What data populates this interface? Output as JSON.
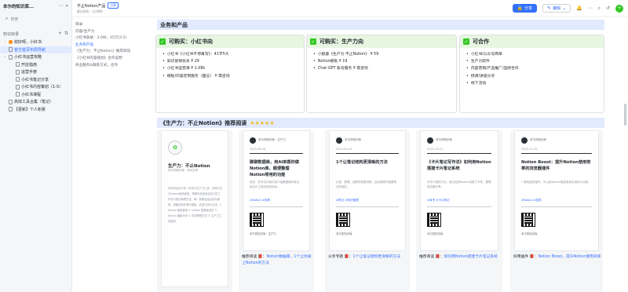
{
  "sidebar": {
    "title": "本尔的知识库...",
    "search_placeholder": "搜索",
    "section_label": "知识目录",
    "items": [
      {
        "label": "收好呀，小红书",
        "level": 1,
        "arrow": "›",
        "icon": "dot-orange"
      },
      {
        "label": "官方首页布局导航",
        "level": 1,
        "arrow": "",
        "icon": "doc",
        "active": true
      },
      {
        "label": "小红书运营攻略",
        "level": 1,
        "arrow": "⌄",
        "icon": "doc"
      },
      {
        "label": "开店指南",
        "level": 2,
        "arrow": "",
        "icon": "doc"
      },
      {
        "label": "运营手册",
        "level": 2,
        "arrow": "",
        "icon": "doc"
      },
      {
        "label": "小红书笔记分享",
        "level": 2,
        "arrow": "",
        "icon": "doc"
      },
      {
        "label": "小红书内容策划（1-5）",
        "level": 2,
        "arrow": "",
        "icon": "doc"
      },
      {
        "label": "小红书课程",
        "level": 2,
        "arrow": "",
        "icon": "doc"
      },
      {
        "label": "高效工具合集（笔记）",
        "level": 1,
        "arrow": "",
        "icon": "doc"
      },
      {
        "label": "【更新】个人积累",
        "level": 1,
        "arrow": "",
        "icon": "doc"
      }
    ]
  },
  "topbar": {
    "title": "不止Notion产品",
    "tag": "分享",
    "subtitle": "最近修改：2分钟前",
    "share_label": "分享",
    "edit_label": "编辑",
    "avatar_letter": "+"
  },
  "toc": {
    "items": [
      "目录",
      "内容/生产力",
      "小红书收录：3.6W，45万(3.5)",
      "业务和产品",
      "《生产力：不止Notion》推荐阅读",
      "《小红书内容规划》合作说明",
      "商业服务&联系方式，合作"
    ],
    "active_index": 3
  },
  "business": {
    "heading": "业务和产品",
    "cards": [
      {
        "title": "可购买：小红书向",
        "items": [
          "小红书《小红书不停再写》：41节5大",
          "知识星球会员 ¥ 29",
          "小红书运营课 ¥ 1.08k",
          "模板/内容定制服务（面议） ¥ 需咨询"
        ]
      },
      {
        "title": "可购买：生产力向",
        "items": [
          "小报童《生产力·不止Notion》 ¥ 59",
          "Notion模板 ¥ 19",
          "Chat-GPT 账号服务 ¥ 需咨询"
        ]
      },
      {
        "title": "可合作",
        "items": [
          "小红书/公众号商单",
          "生产力软件",
          "内容营销/产品推广/品牌合作",
          "授课/讲座分享",
          "线下活动"
        ]
      }
    ]
  },
  "reading": {
    "heading": "《生产力：不止Notion》推荐阅读",
    "stars": "★★★★★",
    "s1": {
      "title": "生产力：不止Notion",
      "sub": "本尔的知识库 · 系列文章",
      "body": "本系列旨在分享一些关于生产力工具、效率方法与Notion使用经验，帮助你找到适合自己的工作流与知识管理方法。每一篇都会结合实际案例，讲解具体步骤与模板。欢迎订阅与交流。1. Notion 基础使用 2. Notion 数据库进阶 3. Notion 模板分享 4. 知识管理方法 5. 生产力工具推荐"
    },
    "pages": [
      {
        "author": "本尔的知识库 · 生产力",
        "date": "2023-08-16",
        "title": "聊聊数据库，用AI来帮你做Notion库，顺便整理Notion常用的功能",
        "text": "前言：在本文中我们将介绍数据库的用法，结合AI工具实现自动化。",
        "tag": "#Notion #效率"
      },
      {
        "author": "本尔的知识库",
        "date": "2023-09-02",
        "title": "1个让笔记结构更清晰的方法",
        "text": "记录、整理、回顾的完整流程，适合刚刚开始做笔记的朋友。",
        "tag": "#笔记 #知识管理"
      },
      {
        "author": "本尔的知识库",
        "date": "2023-10-11",
        "title": "《卡片笔记写作法》如何用Notion搭建卡片笔记系统",
        "text": "书中介绍的方法，我已经用Notion实践了半年，整理成这篇分享。",
        "tag": "#读书 #卡片笔记"
      },
      {
        "author": "本尔的知识库",
        "date": "2023-11-20",
        "title": "Notion Boost：提升Notion使用效率的浏览器插件",
        "text": "一款免费的插件，可以给Notion增加很多实用的小功能。",
        "tag": "#Notion #插件"
      }
    ],
    "captions": [
      {
        "prefix": "推荐阅读 📕：",
        "link": "Notion数据库，1个让你爱上Notion的方法"
      },
      {
        "prefix": "分享专题 📕：",
        "link": "1个让笔记结构更清晰的方法"
      },
      {
        "prefix": "推荐阅读 📕：",
        "link": "如何用Notion搭建卡片笔记系统"
      },
      {
        "prefix": "好用插件 📕：",
        "link": "Notion Boost，提升Notion使用效率"
      }
    ]
  },
  "colors": {
    "accent": "#3370ff",
    "success": "#34c724",
    "heading_bg": "#e1eaff"
  }
}
